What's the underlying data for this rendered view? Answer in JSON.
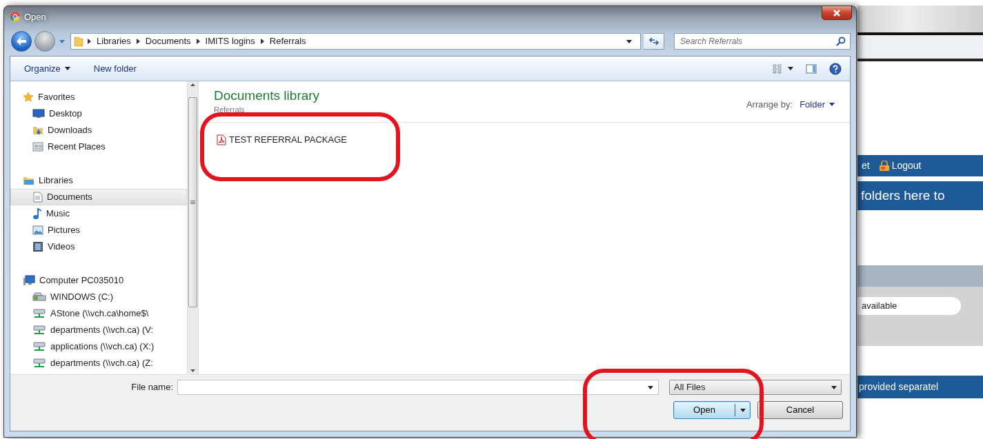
{
  "window": {
    "title": "Open"
  },
  "address": {
    "breadcrumb": [
      "Libraries",
      "Documents",
      "IMITS logins",
      "Referrals"
    ]
  },
  "search": {
    "placeholder": "Search Referrals"
  },
  "toolbar": {
    "buttons": [
      {
        "label": "Organize",
        "kind": "menu"
      },
      {
        "label": "New folder",
        "kind": "plain"
      }
    ]
  },
  "navigation": [
    {
      "label": "Favorites",
      "kind": "star",
      "selected": false,
      "children": [
        {
          "label": "Desktop",
          "kind": "desktop",
          "selected": false
        },
        {
          "label": "Downloads",
          "kind": "downloads",
          "selected": false
        },
        {
          "label": "Recent Places",
          "kind": "recent",
          "selected": false
        }
      ]
    },
    {
      "label": "Libraries",
      "kind": "library",
      "selected": false,
      "children": [
        {
          "label": "Documents",
          "kind": "document",
          "selected": true
        },
        {
          "label": "Music",
          "kind": "music",
          "selected": false
        },
        {
          "label": "Pictures",
          "kind": "pictures",
          "selected": false
        },
        {
          "label": "Videos",
          "kind": "videos",
          "selected": false
        }
      ]
    },
    {
      "label": "Computer PC035010",
      "kind": "computer",
      "selected": false,
      "children": [
        {
          "label": "WINDOWS (C:)",
          "kind": "drive",
          "selected": false
        },
        {
          "label": "AStone (\\\\vch.ca\\home$\\",
          "kind": "network",
          "selected": false
        },
        {
          "label": "departments (\\\\vch.ca) (V:",
          "kind": "network",
          "selected": false
        },
        {
          "label": "applications (\\\\vch.ca) (X:)",
          "kind": "network",
          "selected": false
        },
        {
          "label": "departments (\\\\vch.ca) (Z:",
          "kind": "network",
          "selected": false
        }
      ]
    }
  ],
  "library": {
    "title": "Documents library",
    "subtitle": "Referrals",
    "arrange_label": "Arrange by:",
    "arrange_value": "Folder"
  },
  "files": [
    {
      "name": "TEST REFERRAL PACKAGE",
      "kind": "pdf",
      "selected": false
    }
  ],
  "file_name": {
    "label": "File name:"
  },
  "file_type": {
    "value": "All Files"
  },
  "buttons": [
    {
      "label": "Open",
      "kind": "split",
      "default": true
    },
    {
      "label": "Cancel",
      "kind": "plain",
      "default": false
    }
  ],
  "background_page": {
    "nav_links": [
      {
        "label": "et",
        "kind": "text"
      },
      {
        "label": "Logout",
        "kind": "lock"
      }
    ],
    "heading": "folders here to",
    "field_value": "available",
    "note": "provided separatel"
  }
}
